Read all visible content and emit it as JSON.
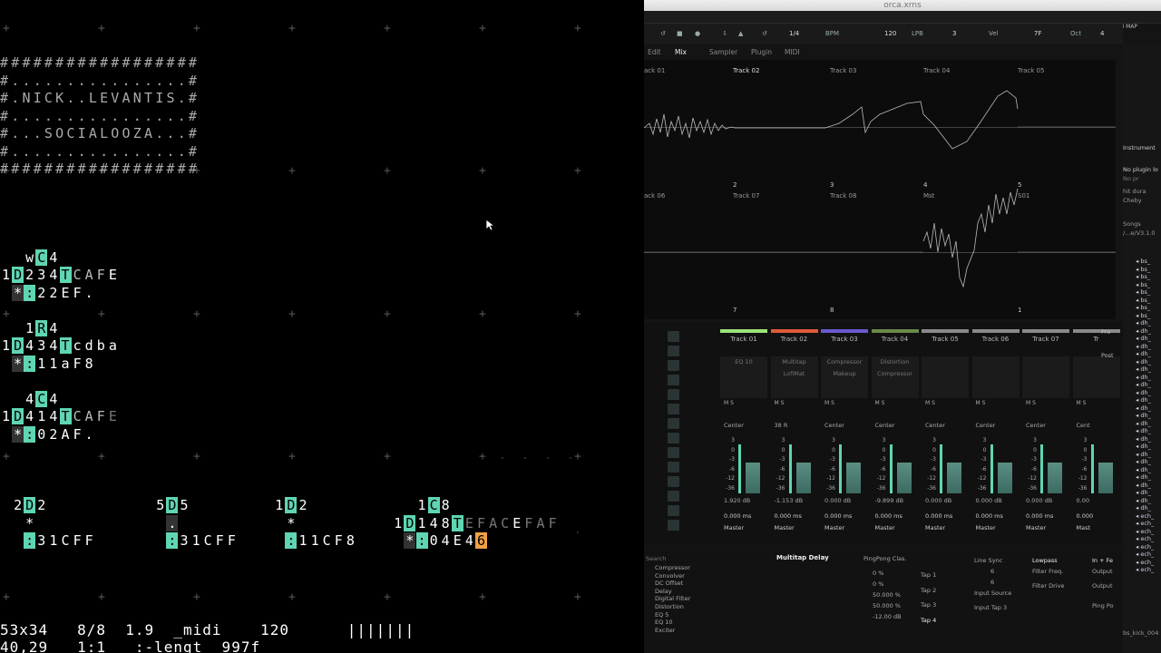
{
  "orca": {
    "banner": [
      "################",
      "#..............#",
      "#.NICK..LEVANTIS.#",
      "#..............#",
      "#...SOCIALOOZA...#",
      "#..............#",
      "################"
    ],
    "banner_exact": [
      "##################",
      "#................#",
      "#.NICK..LEVANTIS.#",
      "#................#",
      "#...SOCIALOOZA...#",
      "#................#",
      "##################"
    ],
    "status_line_1": "53x34   8/8  1.9  _midi    120      |||||||",
    "status_line_2": "40,29   1:1   :-lengt  997f"
  },
  "renoise": {
    "window_title": "orca.xrns",
    "midi_map": "MIDI MAP",
    "transport": {
      "step": "1/4",
      "bpm_label": "BPM",
      "bpm": "120",
      "lpb_label": "LPB",
      "lpb": "3",
      "vel_label": "Vel",
      "vel": "7F",
      "oct_label": "Oct",
      "oct": "4"
    },
    "tabs": {
      "edit": "Edit",
      "mix": "Mix",
      "sampler": "Sampler",
      "plugin": "Plugin",
      "midi": "MIDI"
    },
    "scope_top": [
      {
        "name": "ack 01",
        "num": "2"
      },
      {
        "name": "Track 02",
        "num": "3"
      },
      {
        "name": "Track 03",
        "num": "4"
      },
      {
        "name": "Track 04",
        "num": "5"
      },
      {
        "name": "Track 05",
        "num": ""
      }
    ],
    "scope_bottom": [
      {
        "name": "ack 06",
        "num": "7"
      },
      {
        "name": "Track 07",
        "num": "8"
      },
      {
        "name": "Track 08",
        "num": ""
      },
      {
        "name": "Mst",
        "num": "1"
      },
      {
        "name": "S01",
        "num": ""
      }
    ],
    "channels": [
      {
        "name": "Track 01",
        "color": "#9be37a",
        "dsp": [
          "EQ 10",
          ""
        ],
        "pan": "Center",
        "db": "1.920 dB",
        "delay": "0.000 ms",
        "route": "Master"
      },
      {
        "name": "Track 02",
        "color": "#e05a3a",
        "dsp": [
          "Multitap",
          "LofiMat"
        ],
        "pan": "38 R",
        "db": "-1.153 dB",
        "delay": "0.000 ms",
        "route": "Master"
      },
      {
        "name": "Track 03",
        "color": "#6a5acd",
        "dsp": [
          "Compressor",
          "Makeup"
        ],
        "pan": "Center",
        "db": "0.000 dB",
        "delay": "0.000 ms",
        "route": "Master"
      },
      {
        "name": "Track 04",
        "color": "#6a8a4a",
        "dsp": [
          "Distortion",
          "Compressor"
        ],
        "pan": "Center",
        "db": "-9.899 dB",
        "delay": "0.000 ms",
        "route": "Master"
      },
      {
        "name": "Track 05",
        "color": "#8a8a8a",
        "dsp": [
          "",
          ""
        ],
        "pan": "Center",
        "db": "0.000 dB",
        "delay": "0.000 ms",
        "route": "Master"
      },
      {
        "name": "Track 06",
        "color": "#8a8a8a",
        "dsp": [
          "",
          ""
        ],
        "pan": "Center",
        "db": "0.000 dB",
        "delay": "0.000 ms",
        "route": "Master"
      },
      {
        "name": "Track 07",
        "color": "#8a8a8a",
        "dsp": [
          "",
          ""
        ],
        "pan": "Center",
        "db": "0.000 dB",
        "delay": "0.000 ms",
        "route": "Master"
      },
      {
        "name": "Tr",
        "color": "#8a8a8a",
        "dsp": [
          "",
          ""
        ],
        "pan": "Cent",
        "db": "0.00",
        "delay": "0.000",
        "route": "Mast"
      }
    ],
    "meter_scale": [
      "3",
      "0",
      "-3",
      "-6",
      "-12",
      "-36"
    ],
    "prepost": [
      "Pre",
      "Post"
    ],
    "bottom": {
      "search_placeholder": "Search",
      "effects": [
        "Compressor",
        "Convolver",
        "DC Offset",
        "Delay",
        "Digital Filter",
        "Distortion",
        "EQ 5",
        "EQ 10",
        "Exciter"
      ],
      "device_name": "Multitap Delay",
      "preset": "PingPong Clas.",
      "taps": [
        "Tap 1",
        "Tap 2",
        "Tap 3",
        "Tap 4"
      ],
      "tap_values": [
        "0 %",
        "0 %",
        "50.000 %",
        "50.000 %",
        "-12.00 dB"
      ],
      "line_sync": "Line Sync",
      "sync_vals": [
        "6",
        "6"
      ],
      "input_source": "Input Source",
      "input_tap": "Input Tap 3",
      "filter": "Lowpass",
      "filter_freq": "Filter Freq.",
      "filter_drive": "Filter Drive",
      "in_fe": "In + Fe",
      "output": "Output",
      "output2": "Output",
      "pingpong": "Ping Po"
    },
    "rightpanel": {
      "instrument": "Instrument",
      "no_plugin": "No plugin lo",
      "no_pr": "No pr",
      "hit_dur": "hit dura",
      "cheby": "Cheby",
      "songs": "Songs",
      "path": "/...e/V3.1.0",
      "files": [
        "bs",
        "bs",
        "bs",
        "bs",
        "bs",
        "bs",
        "bs",
        "bs",
        "dh",
        "dh",
        "dh",
        "dh",
        "dh",
        "dh",
        "dh",
        "dh",
        "dh",
        "dh",
        "dh",
        "dh",
        "dh",
        "dh",
        "dh",
        "dh",
        "dh",
        "dh",
        "dh",
        "dh",
        "dh",
        "dh",
        "dh",
        "dh",
        "dh",
        "ech",
        "ech",
        "ech",
        "ech",
        "ech",
        "ech",
        "ech",
        "ech"
      ],
      "footer": "bs_kick_004"
    }
  }
}
